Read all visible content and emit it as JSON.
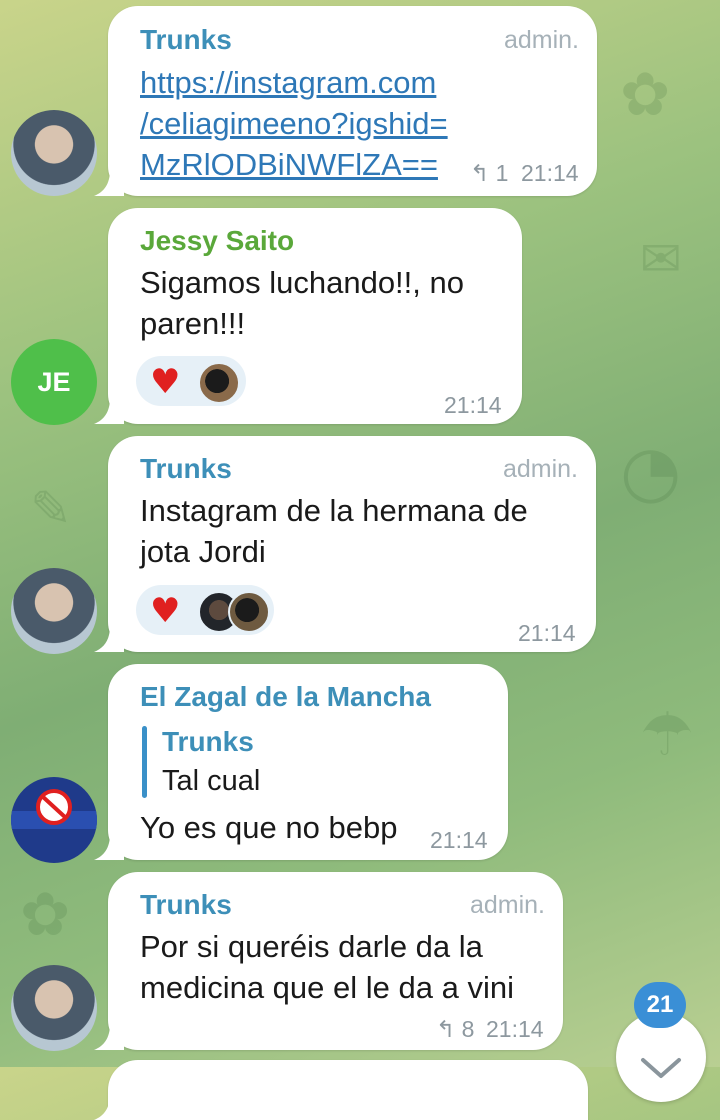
{
  "messages": [
    {
      "sender": "Trunks",
      "role": "admin.",
      "text_lines": [
        "https://instagram.com",
        "/celiagimeeno?igshid=",
        "MzRlODBiNWFlZA=="
      ],
      "replies": "1",
      "time": "21:14"
    },
    {
      "sender": "Jessy Saito",
      "avatar_initials": "JE",
      "text_lines": [
        "Sigamos luchando!!, no",
        "paren!!!"
      ],
      "reaction": "♥",
      "time": "21:14"
    },
    {
      "sender": "Trunks",
      "role": "admin.",
      "text_lines": [
        "Instagram de la hermana de",
        "jota Jordi"
      ],
      "reaction": "♥",
      "time": "21:14"
    },
    {
      "sender": "El Zagal de la Mancha",
      "quote_sender": "Trunks",
      "quote_text": "Tal cual",
      "text": "Yo es que no bebp",
      "time": "21:14"
    },
    {
      "sender": "Trunks",
      "role": "admin.",
      "text_lines": [
        "Por si queréis darle da la",
        "medicina que el le da a vini"
      ],
      "replies": "8",
      "time": "21:14"
    }
  ],
  "scroll": {
    "unread_count": "21"
  },
  "colors": {
    "trunks": "#3d8fb8",
    "jessy": "#5aa83a",
    "zagal": "#3d8fb8",
    "link": "#2e78b7",
    "badge": "#3a8fd6"
  },
  "icons": {
    "reply": "reply-arrow-icon",
    "scroll_down": "chevron-down-icon"
  }
}
